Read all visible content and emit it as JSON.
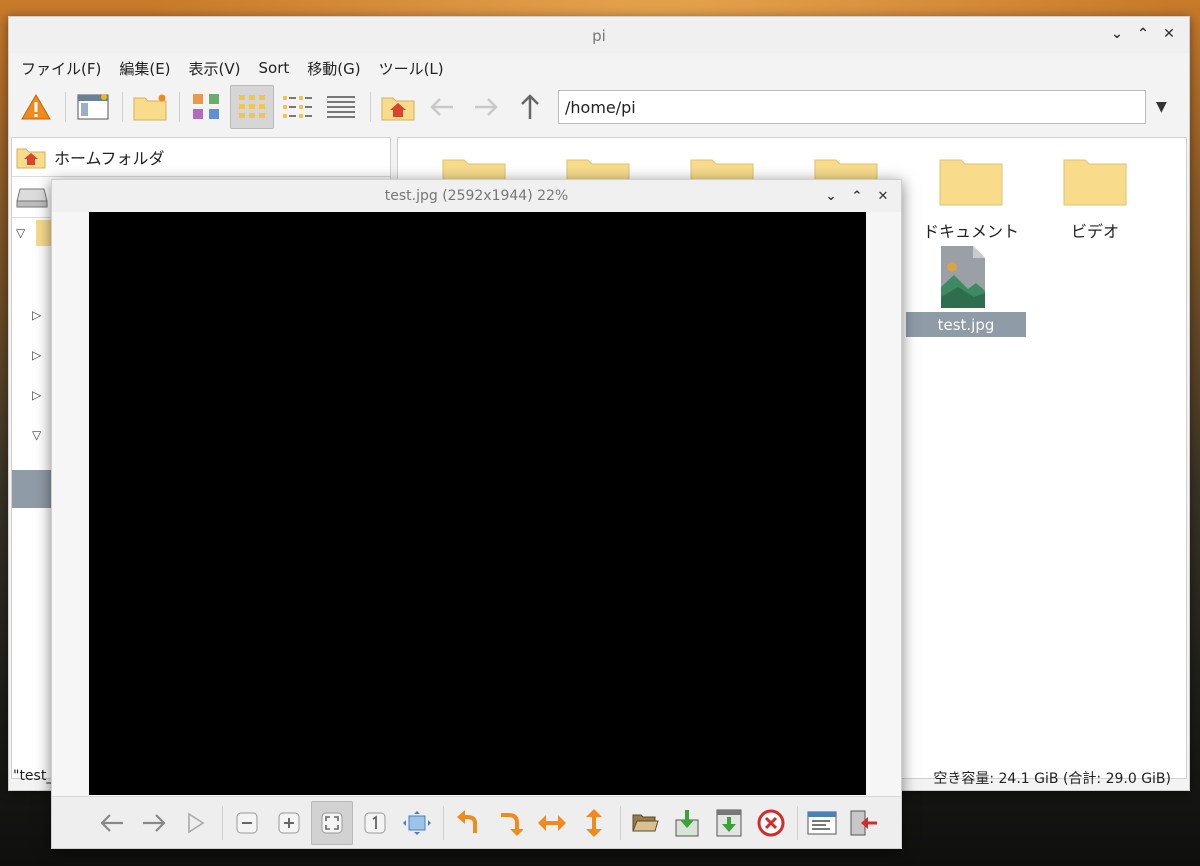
{
  "file_manager": {
    "title": "pi",
    "menu": [
      "ファイル(F)",
      "編集(E)",
      "表示(V)",
      "Sort",
      "移動(G)",
      "ツール(L)"
    ],
    "path": "/home/pi",
    "places_home": "ホームフォルダ",
    "items": [
      {
        "label": "ドキュメント",
        "icon": "folder-icon"
      },
      {
        "label": "ビデオ",
        "icon": "folder-icon"
      },
      {
        "label": "test.jpg",
        "icon": "image-file-icon",
        "selected": true
      }
    ],
    "status_left": "\"test_",
    "status_right": "空き容量: 24.1 GiB (合計: 29.0 GiB)"
  },
  "viewer": {
    "title": "test.jpg (2592x1944) 22%"
  },
  "colors": {
    "selection": "#8f9ba7",
    "folder": "#f8dc8c",
    "accent_orange": "#f08a1c"
  }
}
